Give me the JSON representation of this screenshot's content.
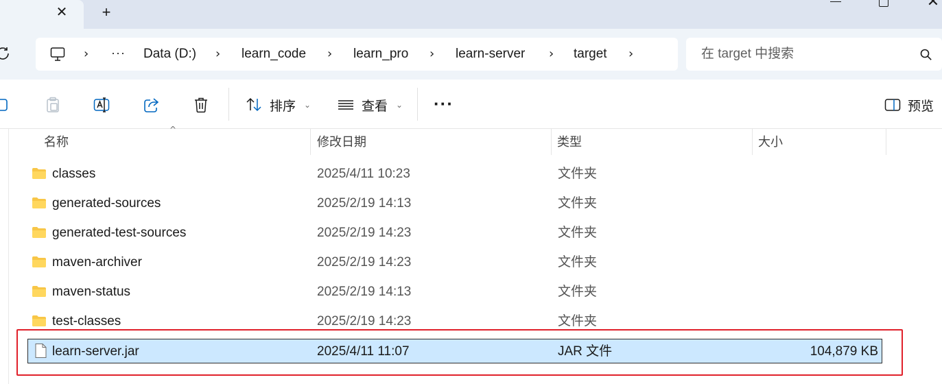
{
  "tabbar": {
    "close_glyph": "✕",
    "new_tab_glyph": "+"
  },
  "window_controls": {
    "close_glyph": "✕"
  },
  "address": {
    "more_glyph": "···",
    "breadcrumbs": [
      "Data (D:)",
      "learn_code",
      "learn_pro",
      "learn-server",
      "target"
    ],
    "separator": "›"
  },
  "search": {
    "placeholder": "在 target 中搜索"
  },
  "toolbar": {
    "sort_label": "排序",
    "view_label": "查看",
    "preview_label": "预览",
    "chevron": "⌄",
    "more_glyph": "···"
  },
  "columns": {
    "name": "名称",
    "modified": "修改日期",
    "type": "类型",
    "size": "大小",
    "sort_glyph": "^"
  },
  "files": [
    {
      "name": "classes",
      "modified": "2025/4/11 10:23",
      "type": "文件夹",
      "size": "",
      "kind": "folder"
    },
    {
      "name": "generated-sources",
      "modified": "2025/2/19 14:13",
      "type": "文件夹",
      "size": "",
      "kind": "folder"
    },
    {
      "name": "generated-test-sources",
      "modified": "2025/2/19 14:23",
      "type": "文件夹",
      "size": "",
      "kind": "folder"
    },
    {
      "name": "maven-archiver",
      "modified": "2025/2/19 14:23",
      "type": "文件夹",
      "size": "",
      "kind": "folder"
    },
    {
      "name": "maven-status",
      "modified": "2025/2/19 14:13",
      "type": "文件夹",
      "size": "",
      "kind": "folder"
    },
    {
      "name": "test-classes",
      "modified": "2025/2/19 14:23",
      "type": "文件夹",
      "size": "",
      "kind": "folder"
    },
    {
      "name": "learn-server.jar",
      "modified": "2025/4/11 11:07",
      "type": "JAR 文件",
      "size": "104,879 KB",
      "kind": "file"
    }
  ],
  "colors": {
    "folder": "#f8c647",
    "selection": "#cce8ff",
    "highlight_frame": "#e0202a",
    "accent": "#0067c0"
  }
}
